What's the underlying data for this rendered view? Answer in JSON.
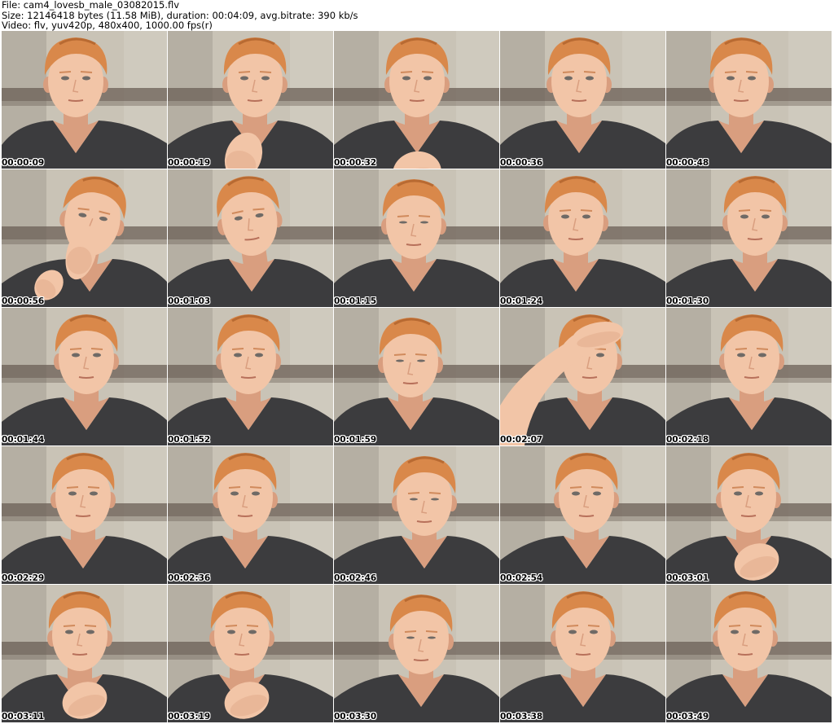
{
  "header": {
    "line1": "File: cam4_lovesb_male_03082015.flv",
    "line2": "Size: 12146418 bytes (11.58 MiB), duration: 00:04:09, avg.bitrate: 390 kb/s",
    "line3": "Video: flv, yuv420p, 480x400, 1000.00 fps(r)"
  },
  "thumbnails": [
    {
      "time": "00:00:09",
      "pose": "neutral"
    },
    {
      "time": "00:00:19",
      "pose": "hand-chin"
    },
    {
      "time": "00:00:32",
      "pose": "hand-neck"
    },
    {
      "time": "00:00:36",
      "pose": "neutral"
    },
    {
      "time": "00:00:48",
      "pose": "neutral"
    },
    {
      "time": "00:00:56",
      "pose": "hand-face"
    },
    {
      "time": "00:01:03",
      "pose": "tilted"
    },
    {
      "time": "00:01:15",
      "pose": "looking-down"
    },
    {
      "time": "00:01:24",
      "pose": "neutral"
    },
    {
      "time": "00:01:30",
      "pose": "neutral"
    },
    {
      "time": "00:01:44",
      "pose": "neutral"
    },
    {
      "time": "00:01:52",
      "pose": "neutral"
    },
    {
      "time": "00:01:59",
      "pose": "looking-down"
    },
    {
      "time": "00:02:07",
      "pose": "hand-head"
    },
    {
      "time": "00:02:18",
      "pose": "neutral"
    },
    {
      "time": "00:02:29",
      "pose": "neutral"
    },
    {
      "time": "00:02:36",
      "pose": "neutral"
    },
    {
      "time": "00:02:46",
      "pose": "looking-down"
    },
    {
      "time": "00:02:54",
      "pose": "neutral"
    },
    {
      "time": "00:03:01",
      "pose": "hand-mouth"
    },
    {
      "time": "00:03:11",
      "pose": "hand-mouth"
    },
    {
      "time": "00:03:19",
      "pose": "hand-mouth"
    },
    {
      "time": "00:03:30",
      "pose": "looking-down"
    },
    {
      "time": "00:03:38",
      "pose": "neutral"
    },
    {
      "time": "00:03:49",
      "pose": "neutral"
    }
  ],
  "colors": {
    "wall": "#c9c3b6",
    "wall_shadow": "#9d978b",
    "headboard": "#6b5f55",
    "skin": "#f2c5a7",
    "skin_shadow": "#d99e7f",
    "hair": "#d9884a",
    "hair_dark": "#b86a32",
    "shirt": "#3c3c3e",
    "shirt_dark": "#2a2a2c"
  }
}
